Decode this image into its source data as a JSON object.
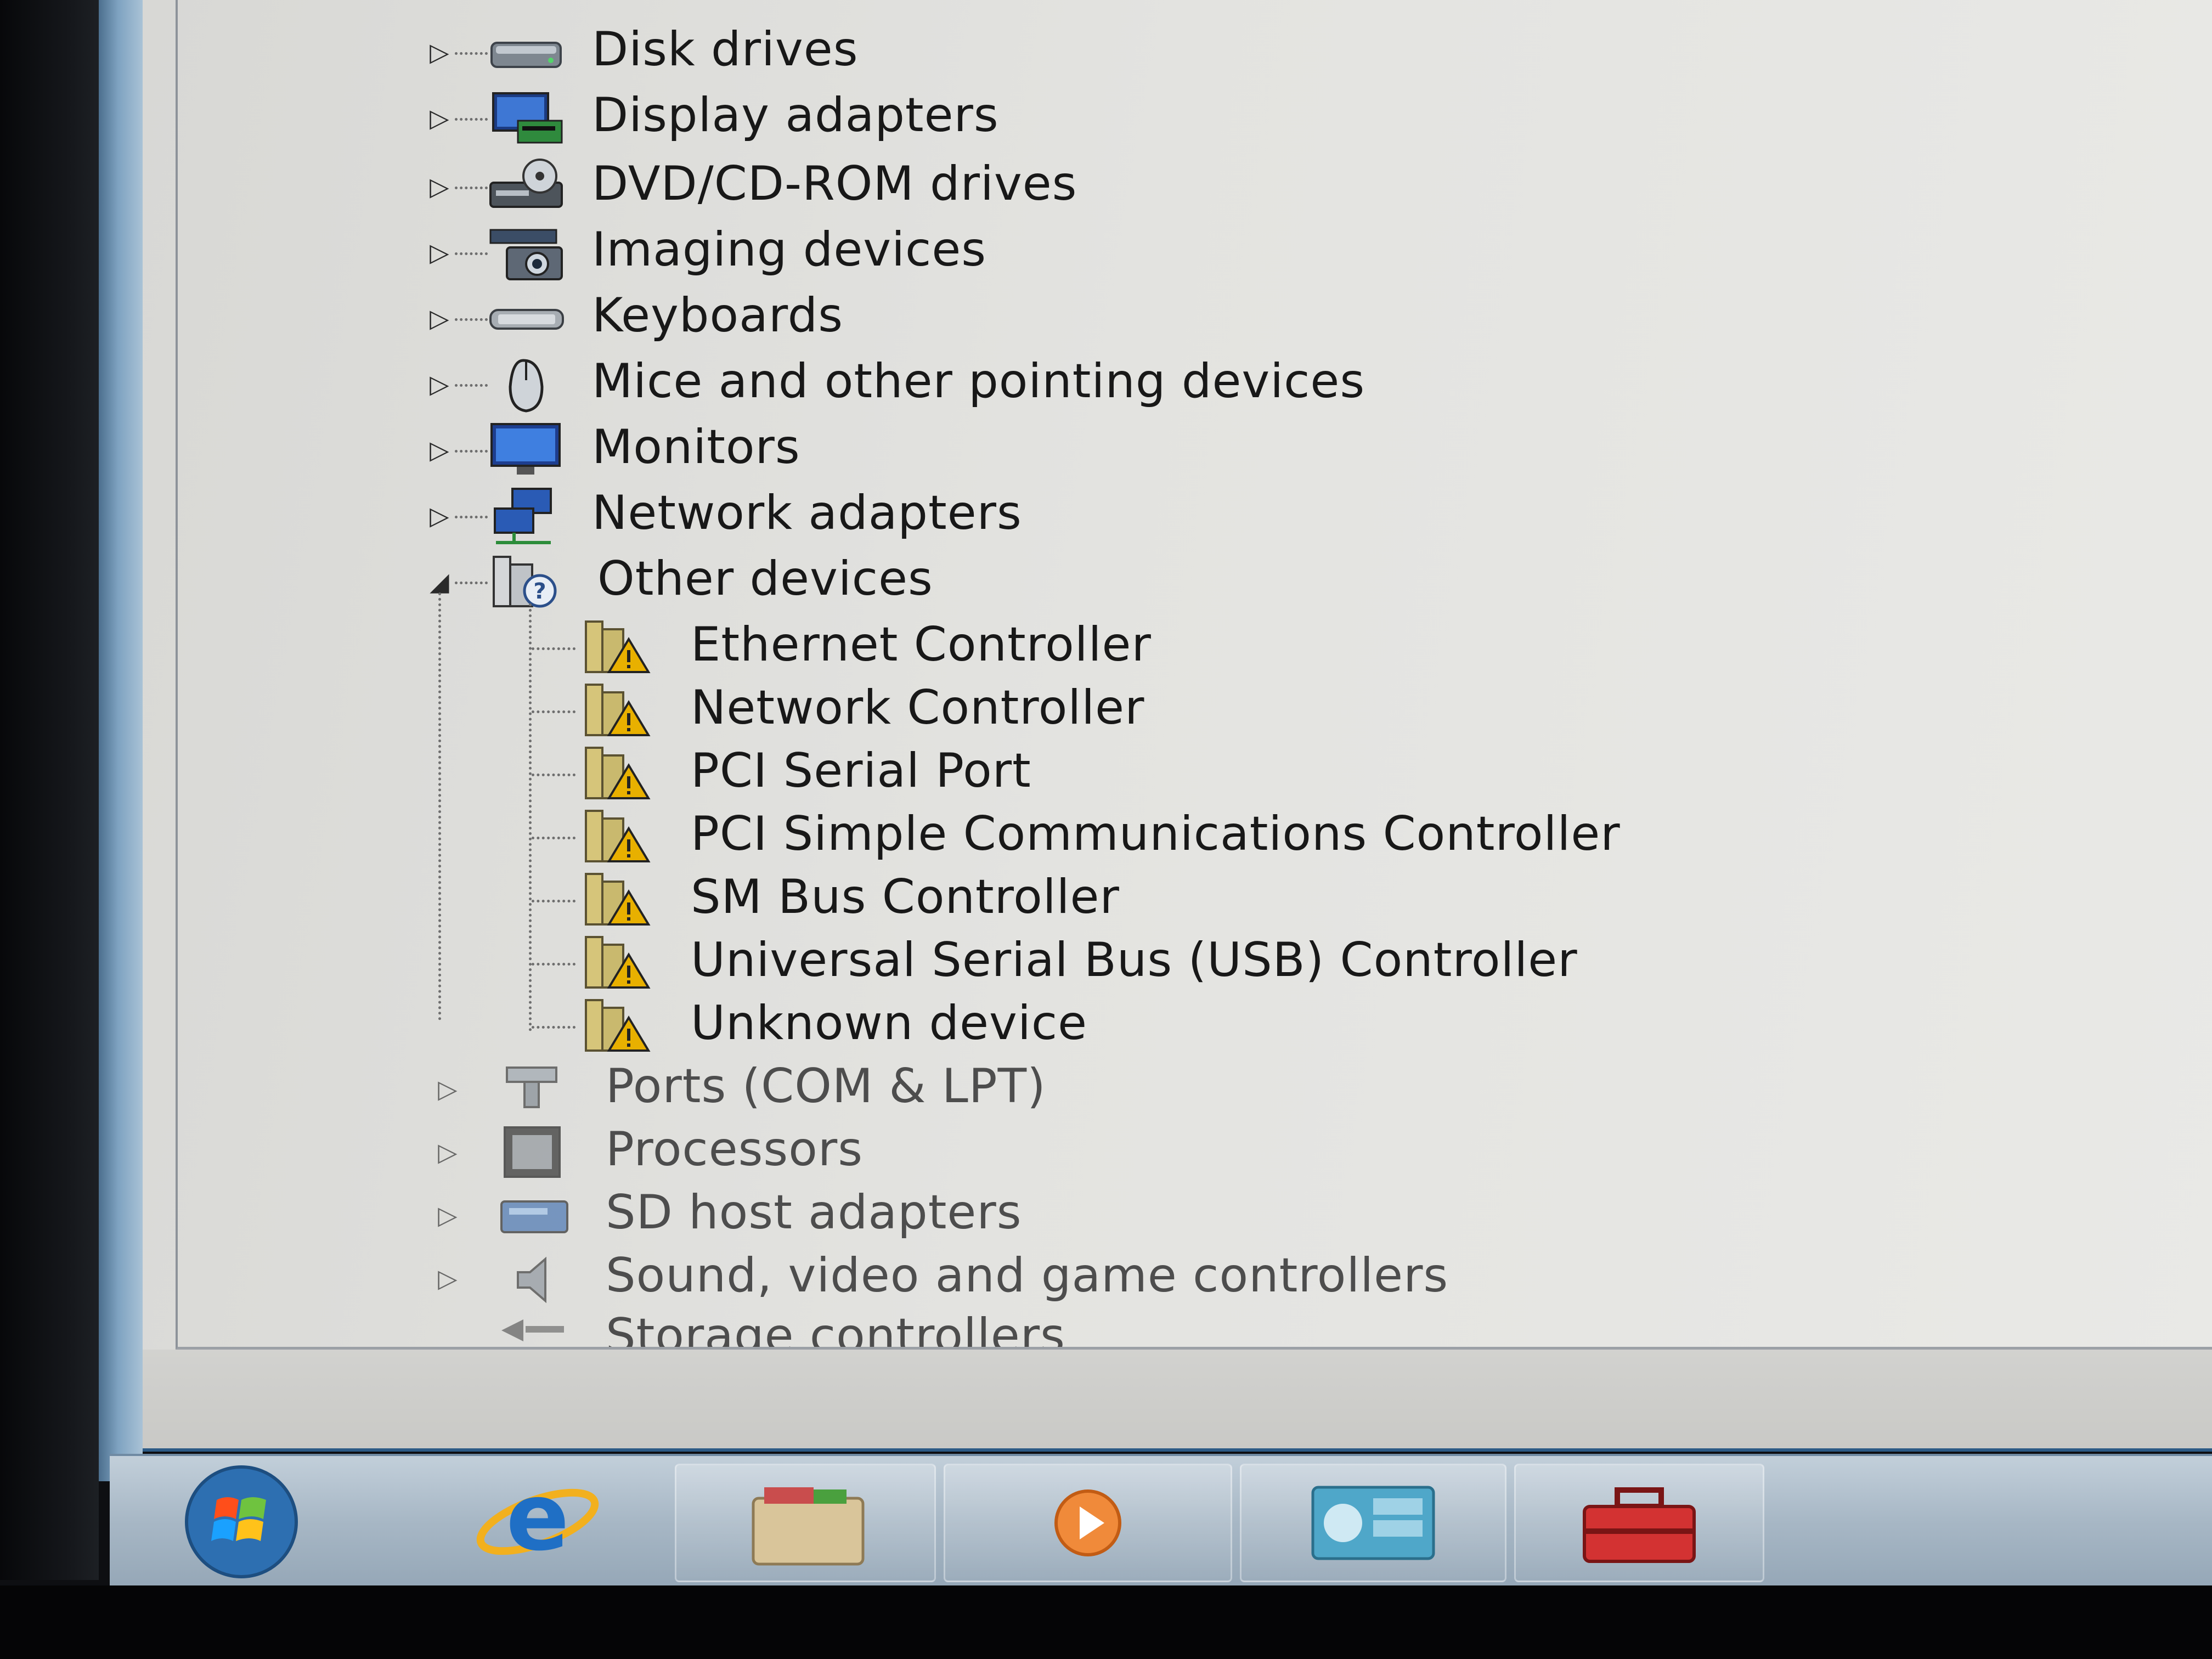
{
  "tree": {
    "categories_top": [
      {
        "label": "Disk drives",
        "icon": "disk-drive-icon"
      },
      {
        "label": "Display adapters",
        "icon": "display-adapter-icon"
      },
      {
        "label": "DVD/CD-ROM drives",
        "icon": "dvd-drive-icon"
      },
      {
        "label": "Imaging devices",
        "icon": "camera-icon"
      },
      {
        "label": "Keyboards",
        "icon": "keyboard-icon"
      },
      {
        "label": "Mice and other pointing devices",
        "icon": "mouse-icon"
      },
      {
        "label": "Monitors",
        "icon": "monitor-icon"
      },
      {
        "label": "Network adapters",
        "icon": "network-adapter-icon"
      }
    ],
    "other_devices": {
      "label": "Other devices",
      "icon": "unknown-device-icon",
      "expanded": true,
      "children": [
        {
          "label": "Ethernet Controller",
          "icon": "warning-device-icon"
        },
        {
          "label": "Network Controller",
          "icon": "warning-device-icon"
        },
        {
          "label": "PCI Serial Port",
          "icon": "warning-device-icon"
        },
        {
          "label": "PCI Simple Communications Controller",
          "icon": "warning-device-icon"
        },
        {
          "label": "SM Bus Controller",
          "icon": "warning-device-icon"
        },
        {
          "label": "Universal Serial Bus (USB) Controller",
          "icon": "warning-device-icon"
        },
        {
          "label": "Unknown device",
          "icon": "warning-device-icon"
        }
      ]
    },
    "categories_bottom": [
      {
        "label": "Ports (COM & LPT)",
        "icon": "port-icon"
      },
      {
        "label": "Processors",
        "icon": "processor-icon"
      },
      {
        "label": "SD host adapters",
        "icon": "sd-adapter-icon"
      },
      {
        "label": "Sound, video and game controllers",
        "icon": "speaker-icon"
      },
      {
        "label": "Storage controllers",
        "icon": "storage-controller-icon"
      }
    ]
  },
  "taskbar": {
    "items": [
      {
        "icon": "start-orb-icon"
      },
      {
        "icon": "internet-explorer-icon"
      },
      {
        "icon": "file-explorer-icon"
      },
      {
        "icon": "media-player-icon"
      },
      {
        "icon": "control-panel-icon"
      },
      {
        "icon": "toolbox-icon"
      }
    ]
  },
  "colors": {
    "warning": "#e8b000",
    "window_bg": "#e3e3e0",
    "taskbar": "#a7b7c5",
    "accent": "#2c5a85"
  }
}
